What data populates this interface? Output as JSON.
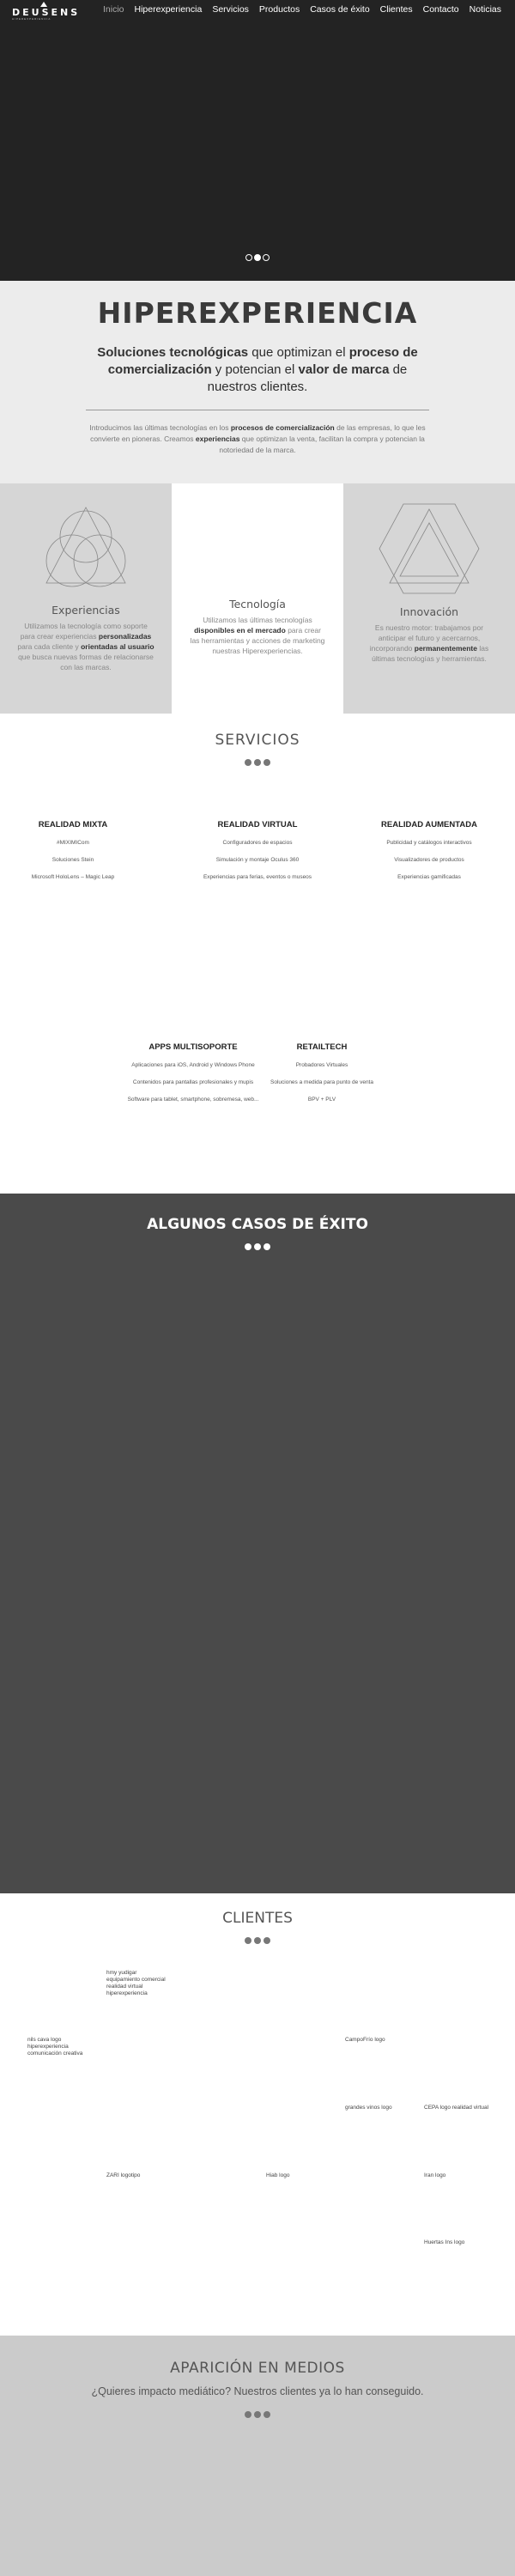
{
  "header": {
    "logo_text": "DEUSENS",
    "logo_tagline": "HIPEREXPERIENCIA",
    "nav": [
      "Inicio",
      "Hiperexperiencia",
      "Servicios",
      "Productos",
      "Casos de éxito",
      "Clientes",
      "Contacto",
      "Noticias"
    ],
    "active_nav": "Inicio"
  },
  "hero": {
    "slides": 3,
    "active_slide": 2
  },
  "intro": {
    "title": "HIPEREXPERIENCIA",
    "subtitle_a": "Soluciones tecnológicas",
    "subtitle_b": " que optimizan el ",
    "subtitle_c": "proceso de comercialización",
    "subtitle_d": " y potencian el ",
    "subtitle_e": "valor de marca",
    "subtitle_f": " de nuestros clientes.",
    "body_a": "Introducimos las últimas tecnologías en los ",
    "body_b": "procesos de comercialización",
    "body_c": " de las empresas, lo que les convierte en pioneras. Creamos ",
    "body_d": "experiencias",
    "body_e": " que optimizan la venta, facilitan la compra y potencian la notoriedad de la marca."
  },
  "panels": {
    "experiencias": {
      "title": "Experiencias",
      "t1": "Utilizamos la tecnología como soporte para crear experiencias ",
      "t2": "personalizadas",
      "t3": " para cada cliente y ",
      "t4": "orientadas al usuario",
      "t5": " que busca nuevas formas de relacionarse con las marcas."
    },
    "tecnologia": {
      "title": "Tecnología",
      "t1": "Utilizamos las últimas tecnologías ",
      "t2": "disponibles en el mercado",
      "t3": " para crear las herramientas y acciones de marketing nuestras Hiperexperiencias."
    },
    "innovacion": {
      "title": "Innovación",
      "t1": "Es nuestro motor: trabajamos por anticipar el futuro y acercarnos, incorporando ",
      "t2": "permanentemente",
      "t3": " las últimas tecnologías y herramientas."
    }
  },
  "servicios": {
    "title": "SERVICIOS",
    "groups": [
      {
        "title": "REALIDAD MIXTA",
        "items": [
          "#MIXIMICom",
          "Soluciones Stein",
          "Microsoft HoloLens – Magic Leap"
        ]
      },
      {
        "title": "REALIDAD VIRTUAL",
        "items": [
          "Configuradores de espacios",
          "Simulación y montaje Oculus 360",
          "Experiencias para ferias, eventos o museos"
        ]
      },
      {
        "title": "REALIDAD AUMENTADA",
        "items": [
          "Publicidad y catálogos interactivos",
          "Visualizadores de productos",
          "Experiencias gamificadas"
        ]
      },
      {
        "title": "APPS MULTISOPORTE",
        "items": [
          "Aplicaciones para iOS, Android y Windows Phone",
          "Contenidos para pantallas profesionales y mupis",
          "Software para tablet, smartphone, sobremesa, web..."
        ]
      },
      {
        "title": "RETAILTECH",
        "items": [
          "Probadores Virtuales",
          "Soluciones a medida para punto de venta",
          "BPV + PLV"
        ]
      }
    ]
  },
  "casos": {
    "title": "ALGUNOS CASOS DE ÉXITO"
  },
  "clientes": {
    "title": "CLIENTES",
    "logos": [
      "hmy yudigar\nequipamiento comercial\nrealidad virtual\nhiperexperiencia",
      "nils cava logo\nhiperexperiencia\ncomunicación creativa",
      "CampoFrío logo",
      "grandes vinos logo",
      "CEPA logo realidad virtual",
      "ZARI logotipo",
      "Hiab logo",
      "Iran logo",
      "Huertas Ins logo"
    ]
  },
  "medios": {
    "title": "APARICIÓN EN MEDIOS",
    "subtitle": "¿Quieres impacto mediático? Nuestros clientes ya lo han conseguido."
  }
}
